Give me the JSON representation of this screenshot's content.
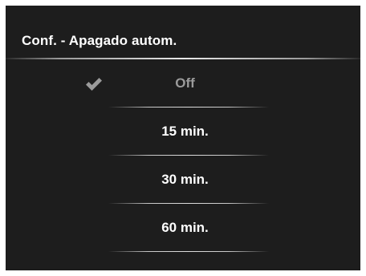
{
  "dialog": {
    "title": "Conf. - Apagado autom."
  },
  "options": [
    {
      "label": "Off",
      "selected": true,
      "icon": "checkmark-icon"
    },
    {
      "label": "15 min.",
      "selected": false
    },
    {
      "label": "30 min.",
      "selected": false
    },
    {
      "label": "60 min.",
      "selected": false
    }
  ],
  "colors": {
    "background": "#1d1d1d",
    "text": "#ffffff",
    "selected_text": "#9b9b9b",
    "checkmark": "#9b9b9b"
  }
}
